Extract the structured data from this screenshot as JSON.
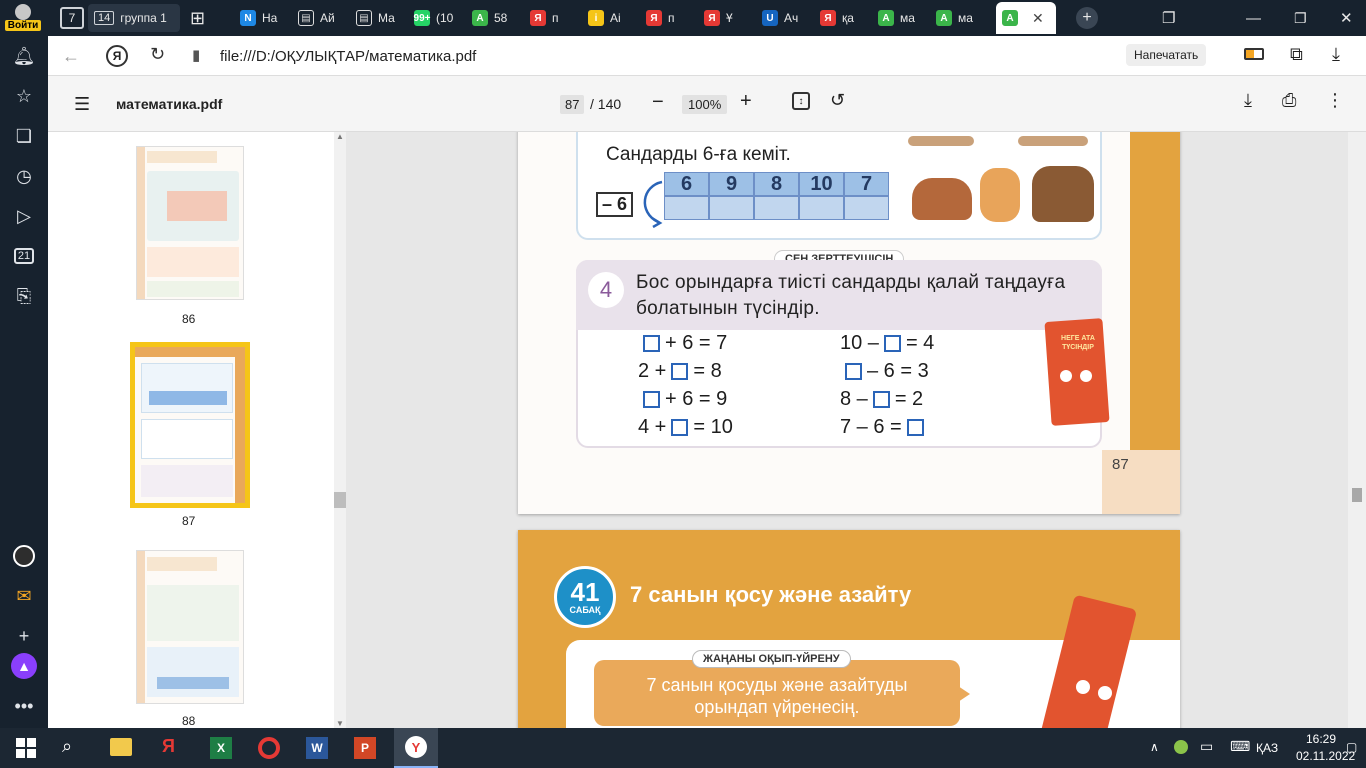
{
  "browser": {
    "login_label": "Войти",
    "tab_counter": "7",
    "group_count": "14",
    "group_label": "группа 1",
    "tabs": [
      {
        "text": "На",
        "color": "#1e88e5",
        "icon": "N"
      },
      {
        "text": "Ай",
        "color": "#eaeaea",
        "icon": "doc"
      },
      {
        "text": "Ма",
        "color": "#eaeaea",
        "icon": "doc"
      },
      {
        "text": "(10",
        "color": "#25d366",
        "icon": "99+"
      },
      {
        "text": "58",
        "color": "#3bb54a",
        "icon": "A"
      },
      {
        "text": "п",
        "color": "#e53935",
        "icon": "Я"
      },
      {
        "text": "Аі",
        "color": "#f5c518",
        "icon": "i"
      },
      {
        "text": "п",
        "color": "#e53935",
        "icon": "Я"
      },
      {
        "text": "Ұ",
        "color": "#e53935",
        "icon": "Я"
      },
      {
        "text": "Ач",
        "color": "#1565c0",
        "icon": "U"
      },
      {
        "text": "қа",
        "color": "#e53935",
        "icon": "Я"
      },
      {
        "text": "ма",
        "color": "#3bb54a",
        "icon": "A"
      },
      {
        "text": "ма",
        "color": "#3bb54a",
        "icon": "A"
      }
    ],
    "url": "file:///D:/ОҚУЛЫҚТАР/математика.pdf",
    "print_button": "Напечатать",
    "sidebar_badge": "21"
  },
  "pdf_toolbar": {
    "filename": "математика.pdf",
    "current_page": "87",
    "total_pages": "/ 140",
    "zoom": "100%"
  },
  "thumbnails": [
    {
      "label": "86"
    },
    {
      "label": "87"
    },
    {
      "label": "88"
    }
  ],
  "page87": {
    "task_title": "Сандарды 6-ға кеміт.",
    "minus_label": "– 6",
    "numbers": [
      "6",
      "9",
      "8",
      "10",
      "7"
    ],
    "section_label": "СЕН ЗЕРТТЕУШІСІҢ",
    "task_number": "4",
    "task4_line1": "Бос орындарға тиісті сандарды қалай таңдауға",
    "task4_line2": "болатынын түсіндір.",
    "eq_left": [
      {
        "before": "",
        "after": "+ 6 = 7"
      },
      {
        "before": "2 +",
        "after": "= 8"
      },
      {
        "before": "",
        "after": "+ 6 = 9"
      },
      {
        "before": "4 +",
        "after": "= 10"
      }
    ],
    "eq_right": [
      {
        "before": "10 –",
        "after": "= 4"
      },
      {
        "before": "",
        "after": "– 6 = 3"
      },
      {
        "before": "8 –",
        "after": "= 2"
      },
      {
        "before": "7 – 6 =",
        "after": ""
      }
    ],
    "book_text": "НЕГЕ АТА ТҮСІНДІР",
    "page_number": "87"
  },
  "page88": {
    "lesson_number": "41",
    "lesson_word": "САБАҚ",
    "lesson_title": "7 санын қосу және азайту",
    "badge": "ЖАҢАНЫ ОҚЫП-ҮЙРЕНУ",
    "goal_line1": "7 санын қосуды және азайтуды",
    "goal_line2": "орындап үйренесің."
  },
  "taskbar": {
    "time": "16:29",
    "date": "02.11.2022",
    "lang": "ҚАЗ"
  }
}
